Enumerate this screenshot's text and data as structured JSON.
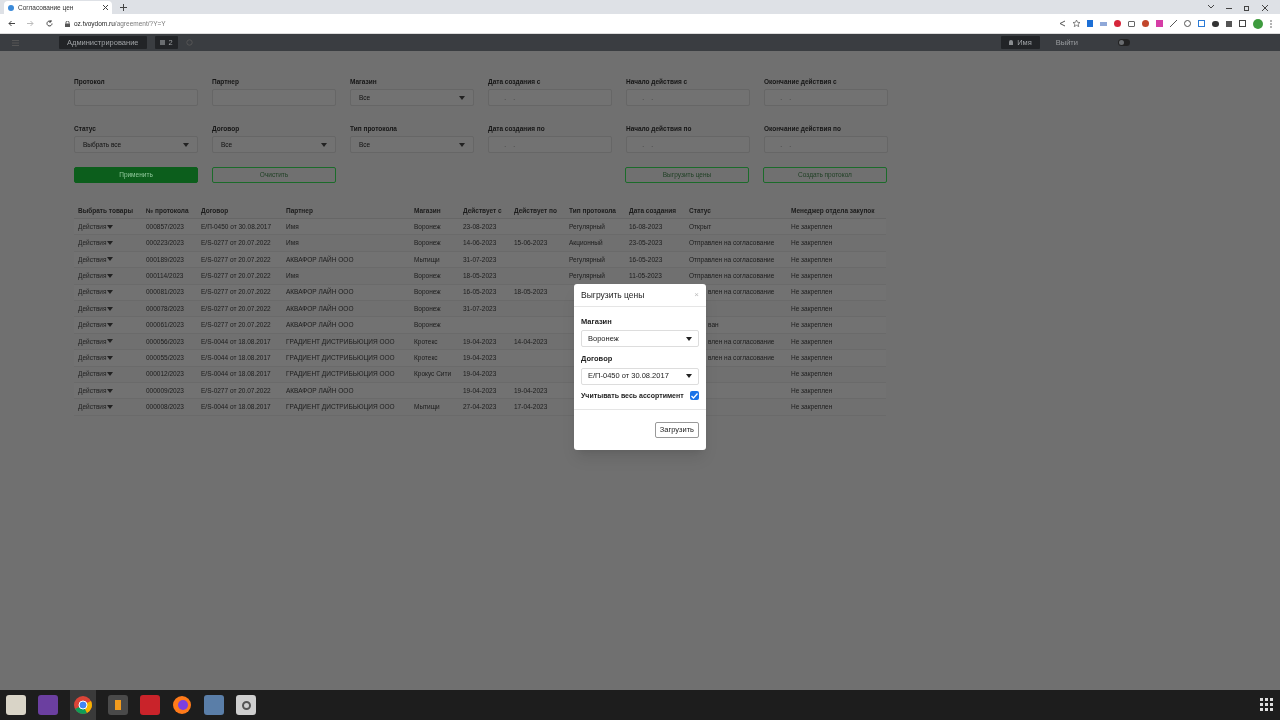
{
  "browser": {
    "tab_title": "Согласование цен",
    "url_host": "oz.tvoydom.ru",
    "url_path": "/agreement/?Y=Y"
  },
  "navbar": {
    "items": [
      {
        "label": "Администрирование",
        "kind": "button"
      },
      {
        "label": "2",
        "kind": "badge"
      }
    ],
    "user": "Имя",
    "logout": "Выйти",
    "toggle_on": false
  },
  "filters": [
    {
      "label": "Протокол",
      "kind": "text"
    },
    {
      "label": "Партнер",
      "kind": "text"
    },
    {
      "label": "Магазин",
      "kind": "select",
      "value": "Все"
    },
    {
      "label": "Дата создания с",
      "kind": "date",
      "placeholder": "__.__.____"
    },
    {
      "label": "Начало действия с",
      "kind": "date",
      "placeholder": "__.__.____"
    },
    {
      "label": "Окончание действия с",
      "kind": "date",
      "placeholder": "__.__.____"
    },
    {
      "label": "Статус",
      "kind": "select",
      "value": "Выбрать все"
    },
    {
      "label": "Договор",
      "kind": "select",
      "value": "Все"
    },
    {
      "label": "Тип протокола",
      "kind": "select",
      "value": "Все"
    },
    {
      "label": "Дата создания по",
      "kind": "date",
      "placeholder": "__.__.____"
    },
    {
      "label": "Начало действия по",
      "kind": "date",
      "placeholder": "__.__.____"
    },
    {
      "label": "Окончание действия по",
      "kind": "date",
      "placeholder": "__.__.____"
    }
  ],
  "buttons_left": [
    {
      "label": "Применить",
      "kind": "primary"
    },
    {
      "label": "Очистить",
      "kind": "outline"
    }
  ],
  "buttons_right": [
    {
      "label": "Выгрузить цены",
      "kind": "outline"
    },
    {
      "label": "Создать протокол",
      "kind": "outline"
    }
  ],
  "table": {
    "columns": [
      "Выбрать товары",
      "№ протокола",
      "Договор",
      "Партнер",
      "Магазин",
      "Действует с",
      "Действует по",
      "Тип протокола",
      "Дата создания",
      "Статус",
      "Менеджер отдела закупок"
    ],
    "rows": [
      {
        "partial": false,
        "cells": [
          "Действия",
          "000857/2023",
          "Е/П-0450 от 30.08.2017",
          "Имя",
          "Воронеж",
          "23-08-2023",
          null,
          "Регулярный",
          "16-08-2023",
          "Открыт",
          "Не закреплен"
        ]
      },
      {
        "partial": false,
        "cells": [
          "Действия",
          "000223/2023",
          "Е/S-0277 от 20.07.2022",
          "Имя",
          "Воронеж",
          "14-06-2023",
          "15-06-2023",
          "Акционный",
          "23-05-2023",
          "Отправлен на согласование",
          "Не закреплен"
        ]
      },
      {
        "partial": false,
        "cells": [
          "Действия",
          "000189/2023",
          "Е/S-0277 от 20.07.2022",
          "АКВАФОР ЛАЙН ООО",
          "Мытищи",
          "31-07-2023",
          null,
          "Регулярный",
          "16-05-2023",
          "Отправлен на согласование",
          "Не закреплен"
        ]
      },
      {
        "partial": false,
        "cells": [
          "Действия",
          "000114/2023",
          "Е/S-0277 от 20.07.2022",
          "Имя",
          "Воронеж",
          "18-05-2023",
          null,
          "Регулярный",
          "11-05-2023",
          "Отправлен на согласование",
          "Не закреплен"
        ]
      },
      {
        "partial": true,
        "cells": [
          "Действия",
          "000081/2023",
          "Е/S-0277 от 20.07.2022",
          "АКВАФОР ЛАЙН ООО",
          "Воронеж",
          "16-05-2023",
          "18-05-2023",
          null,
          null,
          "влен на согласование",
          "Не закреплен"
        ]
      },
      {
        "cells": [
          "Действия",
          "000078/2023",
          "Е/S-0277 от 20.07.2022",
          "АКВАФОР ЛАЙН ООО",
          "Воронеж",
          "31-07-2023",
          null,
          null,
          null,
          null,
          "Не закреплен"
        ]
      },
      {
        "partial": true,
        "cells": [
          "Действия",
          "000061/2023",
          "Е/S-0277 от 20.07.2022",
          "АКВАФОР ЛАЙН ООО",
          "Воронеж",
          null,
          null,
          null,
          null,
          "ван",
          "Не закреплен"
        ]
      },
      {
        "partial": true,
        "cells": [
          "Действия",
          "000056/2023",
          "Е/S-0044 от 18.08.2017",
          "ГРАДИЕНТ ДИСТРИБЬЮЦИЯ ООО",
          "Кротекс",
          "19-04-2023",
          "14-04-2023",
          null,
          null,
          "влен на согласование",
          "Не закреплен"
        ]
      },
      {
        "partial": true,
        "cells": [
          "Действия",
          "000055/2023",
          "Е/S-0044 от 18.08.2017",
          "ГРАДИЕНТ ДИСТРИБЬЮЦИЯ ООО",
          "Кротекс",
          "19-04-2023",
          null,
          null,
          null,
          "влен на согласование",
          "Не закреплен"
        ]
      },
      {
        "cells": [
          "Действия",
          "000012/2023",
          "Е/S-0044 от 18.08.2017",
          "ГРАДИЕНТ ДИСТРИБЬЮЦИЯ ООО",
          "Крокус Сити",
          "19-04-2023",
          null,
          null,
          null,
          null,
          "Не закреплен"
        ]
      },
      {
        "cells": [
          "Действия",
          "000009/2023",
          "Е/S-0277 от 20.07.2022",
          "АКВАФОР ЛАЙН ООО",
          null,
          "19-04-2023",
          "19-04-2023",
          null,
          null,
          null,
          "Не закреплен"
        ]
      },
      {
        "cells": [
          "Действия",
          "000008/2023",
          "Е/S-0044 от 18.08.2017",
          "ГРАДИЕНТ ДИСТРИБЬЮЦИЯ ООО",
          "Мытищи",
          "27-04-2023",
          "17-04-2023",
          null,
          null,
          null,
          "Не закреплен"
        ]
      }
    ]
  },
  "modal": {
    "title": "Выгрузить цены",
    "close": "×",
    "fields": [
      {
        "label": "Магазин",
        "value": "Воронеж"
      },
      {
        "label": "Договор",
        "value": "Е/П-0450 от 30.08.2017"
      }
    ],
    "checkbox": {
      "label": "Учитывать весь ассортимент",
      "checked": true
    },
    "button": "Загрузить"
  }
}
